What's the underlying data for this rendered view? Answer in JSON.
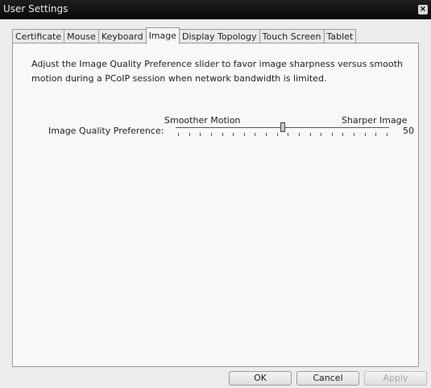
{
  "window": {
    "title": "User Settings",
    "close_glyph": "×"
  },
  "tabs": [
    {
      "label": "Certificate",
      "active": false
    },
    {
      "label": "Mouse",
      "active": false
    },
    {
      "label": "Keyboard",
      "active": false
    },
    {
      "label": "Image",
      "active": true
    },
    {
      "label": "Display Topology",
      "active": false
    },
    {
      "label": "Touch Screen",
      "active": false
    },
    {
      "label": "Tablet",
      "active": false
    }
  ],
  "image_tab": {
    "description": "Adjust the Image Quality Preference slider to favor image sharpness versus smooth motion during a PCoIP session when network bandwidth is limited.",
    "preference_label": "Image Quality Preference:",
    "slider_min_label": "Smoother Motion",
    "slider_max_label": "Sharper Image",
    "slider_value": "50"
  },
  "buttons": {
    "ok": "OK",
    "cancel": "Cancel",
    "apply": "Apply"
  }
}
